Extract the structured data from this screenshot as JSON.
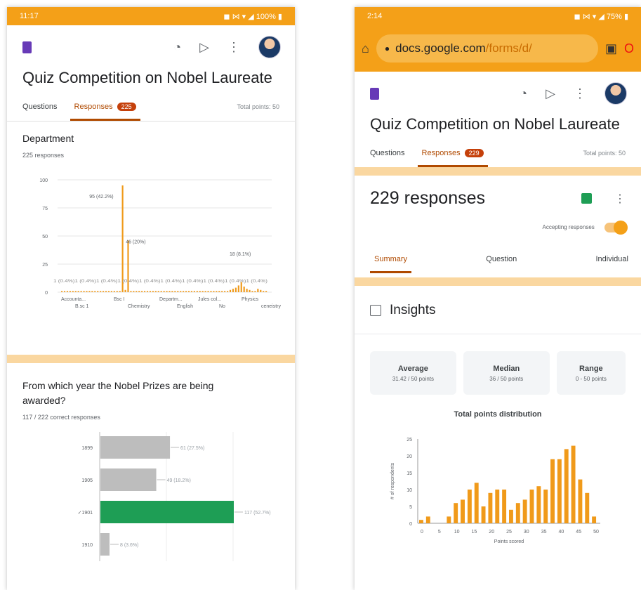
{
  "left": {
    "status": {
      "time": "11:17",
      "right": "◼ ⋈ ▾ ◢ 100% ▮"
    },
    "form_title": "Quiz Competition on Nobel Laureate",
    "tabs": {
      "questions": "Questions",
      "responses": "Responses",
      "badge": "225",
      "points": "Total points: 50"
    },
    "q1": {
      "title": "Department",
      "sub": "225 responses",
      "chart_data": {
        "type": "bar",
        "yticks": [
          "100",
          "75",
          "50",
          "25",
          "0"
        ],
        "ylim": [
          0,
          100
        ],
        "xlabels_row1": [
          "Accounta...",
          "Bsc I",
          "Departm...",
          "Jules col...",
          "Physics"
        ],
        "xlabels_row2": [
          "B.sc 1",
          "Chemistry",
          "English",
          "No",
          "ceneistry"
        ],
        "bars": [
          1,
          1,
          1,
          1,
          1,
          1,
          1,
          1,
          1,
          1,
          1,
          1,
          1,
          1,
          1,
          1,
          1,
          1,
          1,
          1,
          1,
          1,
          95,
          2,
          46,
          1,
          1,
          1,
          1,
          1,
          1,
          1,
          1,
          1,
          1,
          1,
          1,
          1,
          1,
          1,
          1,
          1,
          1,
          1,
          1,
          1,
          1,
          1,
          1,
          1,
          1,
          1,
          1,
          1,
          1,
          1,
          1,
          1,
          1,
          1,
          1,
          2,
          3,
          4,
          6,
          9,
          5,
          3,
          2,
          1,
          1,
          3,
          2,
          1,
          1
        ],
        "labels": [
          "95 (42.2%)",
          "46 (20%)",
          "18 (8.1%)"
        ]
      }
    },
    "q2": {
      "title": "From which year the Nobel Prizes are being awarded?",
      "sub": "117 / 222 correct responses",
      "chart_data": {
        "type": "bar",
        "categories": [
          "1899",
          "1905",
          "✓1901",
          "1910"
        ],
        "values": [
          61,
          49,
          117,
          8
        ],
        "labels": [
          "61 (27.5%)",
          "49 (18.2%)",
          "117 (52.7%)",
          "8 (3.6%)"
        ],
        "correct_index": 2
      }
    }
  },
  "right": {
    "status": {
      "time": "2:14",
      "right": "◼ ⋈ ▾ ◢ 75% ▮"
    },
    "url": {
      "host": "docs.google.com",
      "path": "/forms/d/"
    },
    "form_title": "Quiz Competition on Nobel Laureate",
    "tabs": {
      "questions": "Questions",
      "responses": "Responses",
      "badge": "229",
      "points": "Total points: 50"
    },
    "responses_heading": "229 responses",
    "accepting": "Accepting responses",
    "subtabs": {
      "summary": "Summary",
      "question": "Question",
      "individual": "Individual"
    },
    "insights": "Insights",
    "stats": {
      "average_label": "Average",
      "average_value": "31.42 / 50 points",
      "median_label": "Median",
      "median_value": "36 / 50 points",
      "range_label": "Range",
      "range_value": "0 - 50 points"
    },
    "chart_title": "Total points distribution",
    "chart_data": {
      "type": "bar",
      "ylabel": "# of respondents",
      "xlabel": "Points scored",
      "yticks": [
        "25",
        "20",
        "15",
        "10",
        "5",
        "0"
      ],
      "ylim": [
        0,
        25
      ],
      "xticks": [
        "0",
        "5",
        "10",
        "15",
        "20",
        "25",
        "30",
        "35",
        "40",
        "45",
        "50"
      ],
      "values": [
        1,
        2,
        0,
        0,
        2,
        6,
        7,
        10,
        12,
        5,
        9,
        10,
        10,
        4,
        6,
        7,
        10,
        11,
        10,
        19,
        19,
        22,
        23,
        13,
        9,
        2
      ]
    }
  },
  "colors": {
    "orange": "#f4a018",
    "accent": "#b04a00",
    "bar": "#f09a1a",
    "gray_bar": "#bdbdbd",
    "green": "#1e9e55"
  }
}
